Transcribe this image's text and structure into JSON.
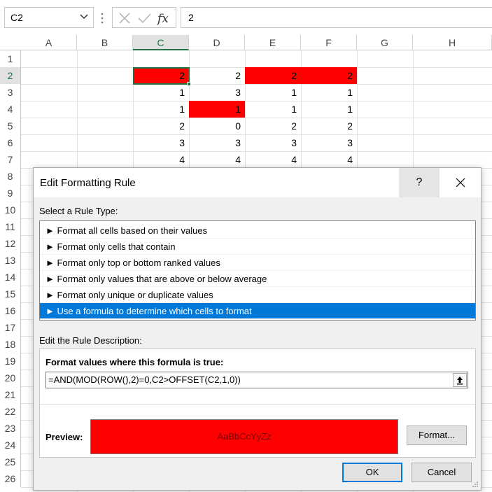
{
  "formula_bar": {
    "name_box": "C2",
    "formula_value": "2"
  },
  "columns": [
    "A",
    "B",
    "C",
    "D",
    "E",
    "F",
    "G",
    "H"
  ],
  "selected_column": "C",
  "rows": [
    "1",
    "2",
    "3",
    "4",
    "5",
    "6",
    "7",
    "8",
    "9",
    "10",
    "11",
    "12",
    "13",
    "14",
    "15",
    "16",
    "17",
    "18",
    "19",
    "20",
    "21",
    "22",
    "23",
    "24",
    "25",
    "26"
  ],
  "selected_row": "2",
  "cells": {
    "C2": "2",
    "D2": "2",
    "E2": "2",
    "F2": "2",
    "C3": "1",
    "D3": "3",
    "E3": "1",
    "F3": "1",
    "C4": "1",
    "D4": "1",
    "E4": "1",
    "F4": "1",
    "C5": "2",
    "D5": "0",
    "E5": "2",
    "F5": "2",
    "C6": "3",
    "D6": "3",
    "E6": "3",
    "F6": "3",
    "C7": "4",
    "D7": "4",
    "E7": "4",
    "F7": "4"
  },
  "highlight_color": "#ff0000",
  "dialog": {
    "title": "Edit Formatting Rule",
    "help_label": "?",
    "select_rule_type_label": "Select a Rule Type:",
    "rule_types": [
      "► Format all cells based on their values",
      "► Format only cells that contain",
      "► Format only top or bottom ranked values",
      "► Format only values that are above or below average",
      "► Format only unique or duplicate values",
      "► Use a formula to determine which cells to format"
    ],
    "selected_rule_index": 5,
    "edit_description_label": "Edit the Rule Description:",
    "formula_label": "Format values where this formula is true:",
    "formula": "=AND(MOD(ROW(),2)=0,C2>OFFSET(C2,1,0))",
    "preview_label": "Preview:",
    "preview_text": "AaBbCcYyZz",
    "preview_fill": "#ff0000",
    "format_button": "Format...",
    "ok_button": "OK",
    "cancel_button": "Cancel",
    "accent": "#0078d7"
  }
}
